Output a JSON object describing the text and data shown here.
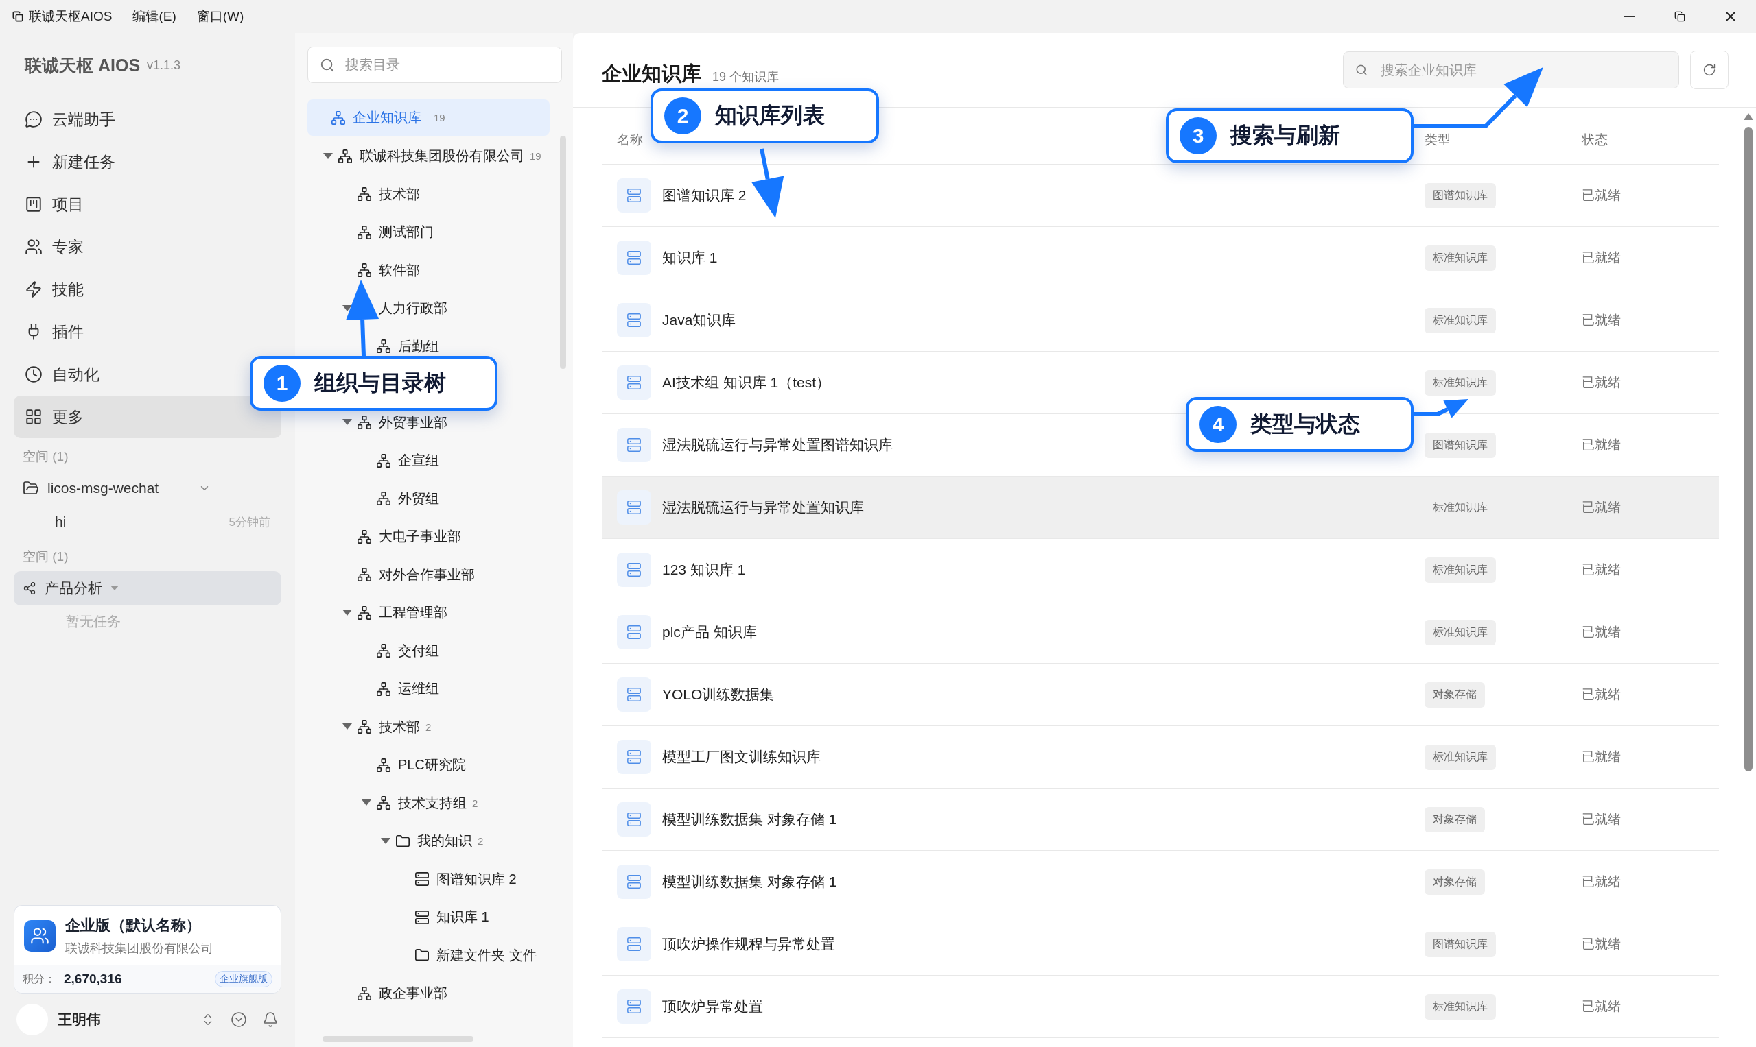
{
  "titlebar": {
    "app_name": "联诚天枢AIOS",
    "menus": [
      "编辑(E)",
      "窗口(W)"
    ]
  },
  "sidebar": {
    "brand": "联诚天枢 AIOS",
    "version": "v1.1.3",
    "nav": [
      {
        "kind": "chat",
        "label": "云端助手",
        "selected": false
      },
      {
        "kind": "plus",
        "label": "新建任务",
        "selected": false
      },
      {
        "kind": "kanban",
        "label": "项目",
        "selected": false
      },
      {
        "kind": "experts",
        "label": "专家",
        "selected": false
      },
      {
        "kind": "skills",
        "label": "技能",
        "selected": false
      },
      {
        "kind": "plugins",
        "label": "插件",
        "selected": false
      },
      {
        "kind": "clock",
        "label": "自动化",
        "selected": false
      },
      {
        "kind": "grid",
        "label": "更多",
        "selected": true
      }
    ],
    "spaces": [
      {
        "heading": "空间 (1)",
        "project": {
          "kind": "folder",
          "label": "licos-msg-wechat",
          "selected": false
        },
        "tasks": [
          {
            "title": "hi",
            "time": "5分钟前"
          }
        ]
      },
      {
        "heading": "空间 (1)",
        "project": {
          "kind": "share",
          "label": "产品分析",
          "selected": true
        },
        "empty": "暂无任务"
      }
    ],
    "org_card": {
      "title": "企业版（默认名称）",
      "company": "联诚科技集团股份有限公司",
      "points_label": "积分：",
      "points": "2,670,316",
      "plan": "企业旗舰版"
    },
    "user": {
      "name": "王明伟"
    }
  },
  "tree": {
    "search_placeholder": "搜索目录",
    "root": {
      "label": "企业知识库",
      "count": "19",
      "selected": true
    },
    "nodes": [
      {
        "kind": "org",
        "label": "联诚科技集团股份有限公司",
        "count": "19",
        "expanded": true,
        "children": [
          {
            "kind": "org",
            "label": "技术部"
          },
          {
            "kind": "org",
            "label": "测试部门"
          },
          {
            "kind": "org",
            "label": "软件部"
          },
          {
            "kind": "org",
            "label": "人力行政部",
            "expanded": true,
            "children": [
              {
                "kind": "org",
                "label": "后勤组"
              }
            ]
          },
          {
            "kind": "covered"
          },
          {
            "kind": "org",
            "label": "外贸事业部",
            "expanded": true,
            "children": [
              {
                "kind": "org",
                "label": "企宣组"
              },
              {
                "kind": "org",
                "label": "外贸组"
              }
            ]
          },
          {
            "kind": "org",
            "label": "大电子事业部"
          },
          {
            "kind": "org",
            "label": "对外合作事业部"
          },
          {
            "kind": "org",
            "label": "工程管理部",
            "expanded": true,
            "children": [
              {
                "kind": "org",
                "label": "交付组"
              },
              {
                "kind": "org",
                "label": "运维组"
              }
            ]
          },
          {
            "kind": "org",
            "label": "技术部",
            "count": "2",
            "expanded": true,
            "children": [
              {
                "kind": "org",
                "label": "PLC研究院"
              },
              {
                "kind": "org",
                "label": "技术支持组",
                "count": "2",
                "expanded": true,
                "children": [
                  {
                    "kind": "folder",
                    "label": "我的知识",
                    "count": "2",
                    "expanded": true,
                    "children": [
                      {
                        "kind": "kb",
                        "label": "图谱知识库 2"
                      },
                      {
                        "kind": "kb",
                        "label": "知识库 1"
                      },
                      {
                        "kind": "folder",
                        "label": "新建文件夹 文件"
                      }
                    ]
                  }
                ]
              }
            ]
          },
          {
            "kind": "org",
            "label": "政企事业部"
          }
        ]
      }
    ]
  },
  "main": {
    "title": "企业知识库",
    "subtitle": "19 个知识库",
    "search_placeholder": "搜索企业知识库",
    "columns": [
      "名称",
      "类型",
      "状态"
    ],
    "rows": [
      {
        "name": "图谱知识库 2",
        "type": "图谱知识库",
        "status": "已就绪",
        "hovered": false
      },
      {
        "name": "知识库 1",
        "type": "标准知识库",
        "status": "已就绪",
        "hovered": false
      },
      {
        "name": "Java知识库",
        "type": "标准知识库",
        "status": "已就绪",
        "hovered": false
      },
      {
        "name": "AI技术组 知识库 1（test）",
        "type": "标准知识库",
        "status": "已就绪",
        "hovered": false
      },
      {
        "name": "湿法脱硫运行与异常处置图谱知识库",
        "type": "图谱知识库",
        "status": "已就绪",
        "hovered": false
      },
      {
        "name": "湿法脱硫运行与异常处置知识库",
        "type": "标准知识库",
        "status": "已就绪",
        "hovered": true
      },
      {
        "name": "123 知识库 1",
        "type": "标准知识库",
        "status": "已就绪",
        "hovered": false
      },
      {
        "name": "plc产品 知识库",
        "type": "标准知识库",
        "status": "已就绪",
        "hovered": false
      },
      {
        "name": "YOLO训练数据集",
        "type": "对象存储",
        "status": "已就绪",
        "hovered": false
      },
      {
        "name": "模型工厂图文训练知识库",
        "type": "标准知识库",
        "status": "已就绪",
        "hovered": false
      },
      {
        "name": "模型训练数据集 对象存储 1",
        "type": "对象存储",
        "status": "已就绪",
        "hovered": false
      },
      {
        "name": "模型训练数据集 对象存储 1",
        "type": "对象存储",
        "status": "已就绪",
        "hovered": false
      },
      {
        "name": "顶吹炉操作规程与异常处置",
        "type": "图谱知识库",
        "status": "已就绪",
        "hovered": false
      },
      {
        "name": "顶吹炉异常处置",
        "type": "标准知识库",
        "status": "已就绪",
        "hovered": false
      }
    ]
  },
  "callouts": [
    {
      "number": "1",
      "label": "组织与目录树"
    },
    {
      "number": "2",
      "label": "知识库列表"
    },
    {
      "number": "3",
      "label": "搜索与刷新"
    },
    {
      "number": "4",
      "label": "类型与状态"
    }
  ]
}
